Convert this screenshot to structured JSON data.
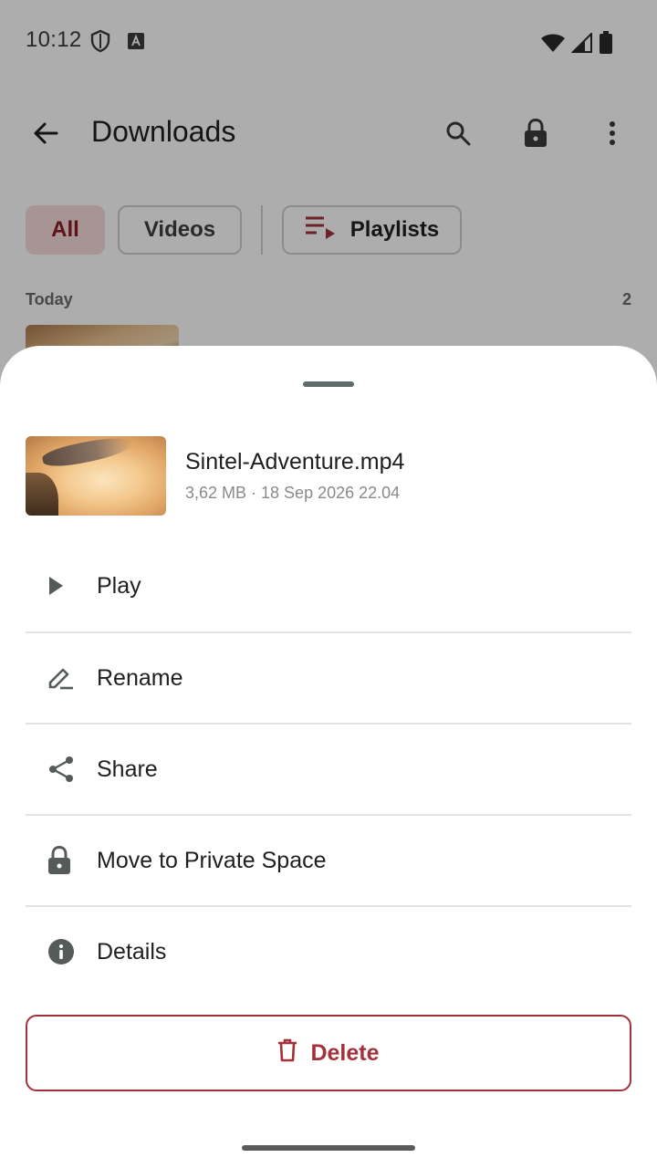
{
  "status_bar": {
    "time": "10:12",
    "icons": [
      "shield-icon",
      "a-notification-icon",
      "wifi-icon",
      "signal-icon",
      "battery-icon"
    ]
  },
  "topbar": {
    "title": "Downloads",
    "icons": [
      "back-arrow-icon",
      "search-icon",
      "lock-icon",
      "more-vert-icon"
    ]
  },
  "filters": {
    "all_label": "All",
    "videos_label": "Videos",
    "playlists_label": "Playlists",
    "active": "All"
  },
  "section": {
    "title": "Today",
    "count": "2"
  },
  "sheet": {
    "file_name": "Sintel-Adventure.mp4",
    "file_meta": "3,62 MB · 18 Sep 2026 22.04",
    "menu": [
      {
        "label": "Play",
        "icon": "play-icon"
      },
      {
        "label": "Rename",
        "icon": "rename-icon"
      },
      {
        "label": "Share",
        "icon": "share-icon"
      },
      {
        "label": "Move to Private Space",
        "icon": "lock-icon"
      },
      {
        "label": "Details",
        "icon": "info-icon"
      }
    ],
    "delete_label": "Delete"
  },
  "colors": {
    "accent": "#a3313a",
    "chip_active_bg": "#f7dcdc",
    "scrim": "rgba(0,0,0,0.32)"
  }
}
